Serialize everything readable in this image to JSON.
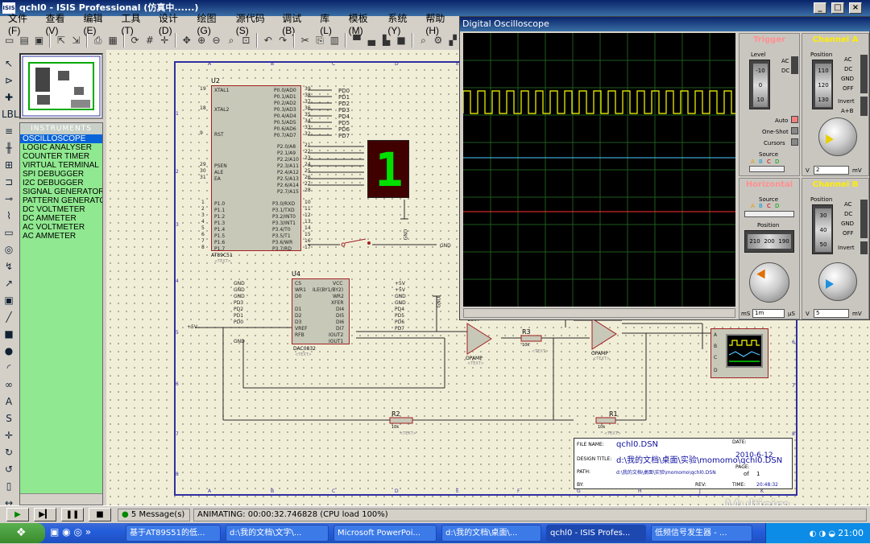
{
  "window": {
    "title": "qchl0 - ISIS Professional (仿真中......)",
    "icon_text": "ISIS"
  },
  "menu": [
    "文件(F)",
    "查看(V)",
    "编辑(E)",
    "工具(T)",
    "设计(D)",
    "绘图(G)",
    "源代码(S)",
    "调试(B)",
    "库(L)",
    "模板(M)",
    "系统(Y)",
    "帮助(H)"
  ],
  "instruments": {
    "header": "INSTRUMENTS",
    "items": [
      "OSCILLOSCOPE",
      "LOGIC ANALYSER",
      "COUNTER TIMER",
      "VIRTUAL TERMINAL",
      "SPI DEBUGGER",
      "I2C DEBUGGER",
      "SIGNAL GENERATOR",
      "PATTERN GENERATOR",
      "DC VOLTMETER",
      "DC AMMETER",
      "AC VOLTMETER",
      "AC AMMETER"
    ],
    "selected": "OSCILLOSCOPE"
  },
  "schematic": {
    "u2": {
      "ref": "U2",
      "part": "AT89C51",
      "text": "<TEXT>",
      "left_pins": [
        "XTAL1",
        "XTAL2",
        "RST",
        "PSEN",
        "ALE",
        "EA",
        "P1.0",
        "P1.1",
        "P1.2",
        "P1.3",
        "P1.4",
        "P1.5",
        "P1.6",
        "P1.7"
      ],
      "left_nums": [
        "19",
        "18",
        "9",
        "29",
        "30",
        "31",
        "1",
        "2",
        "3",
        "4",
        "5",
        "6",
        "7",
        "8"
      ],
      "right_pins": [
        "P0.0/AD0",
        "P0.1/AD1",
        "P0.2/AD2",
        "P0.3/AD3",
        "P0.4/AD4",
        "P0.5/AD5",
        "P0.6/AD6",
        "P0.7/AD7",
        "P2.0/A8",
        "P2.1/A9",
        "P2.2/A10",
        "P2.3/A11",
        "P2.4/A12",
        "P2.5/A13",
        "P2.6/A14",
        "P2.7/A15",
        "P3.0/RXD",
        "P3.1/TXD",
        "P3.2/INT0",
        "P3.3/INT1",
        "P3.4/T0",
        "P3.5/T1",
        "P3.6/WR",
        "P3.7/RD"
      ],
      "right_nums": [
        "39",
        "38",
        "37",
        "36",
        "35",
        "34",
        "33",
        "32",
        "21",
        "22",
        "23",
        "24",
        "25",
        "26",
        "27",
        "28",
        "10",
        "11",
        "12",
        "13",
        "14",
        "15",
        "16",
        "17"
      ]
    },
    "p0_labels": [
      "PD0",
      "PD1",
      "PD2",
      "PD3",
      "PD4",
      "PD5",
      "PD6",
      "PD7"
    ],
    "gnd": "GND",
    "display_digit": "1",
    "u4": {
      "ref": "U4",
      "part": "DAC0832",
      "text": "<TEXT>",
      "left_pins": [
        "CS",
        "WR1",
        "D0",
        "D1",
        "D2",
        "D3",
        "VREF",
        "RFB"
      ],
      "right_pins": [
        "VCC",
        "ILE(BY1/BY2)",
        "WR2",
        "XFER",
        "DI4",
        "DI5",
        "DI6",
        "DI7",
        "IOUT2",
        "IOUT1"
      ],
      "left_nets": [
        "GND",
        "GND",
        "GND",
        "PD3",
        "PD2",
        "PD1",
        "PD0",
        "GND"
      ],
      "right_nets": [
        "+5V",
        "+5V",
        "GND",
        "GND",
        "PD4",
        "PD5",
        "PD6",
        "PD7"
      ],
      "vref_net": "+5V"
    },
    "u3": {
      "ref": "U3:A",
      "part": "OPAMP",
      "text": "<TEXT>"
    },
    "opamp2": {
      "part": "OPAMP",
      "text": "<TEXT>"
    },
    "r3": {
      "ref": "R3",
      "value": "10k",
      "text": "<TEXT>"
    },
    "r2": {
      "ref": "R2",
      "value": "10k",
      "text": "<TEXT>"
    },
    "r1": {
      "ref": "R1",
      "value": "10k",
      "text": "<TEXT>"
    },
    "scope_channels": [
      "A",
      "B",
      "C",
      "D"
    ],
    "col_labels": [
      "A",
      "B",
      "C",
      "D",
      "E",
      "F",
      "G",
      "H",
      "J",
      "K"
    ],
    "row_labels": [
      "1",
      "2",
      "3",
      "4",
      "5",
      "6",
      "7",
      "8"
    ],
    "title_block": {
      "file_name_label": "FILE NAME:",
      "file_name": "qchl0.DSN",
      "design_title_label": "DESIGN TITLE:",
      "design_title": "d:\\我的文档\\桌面\\实验\\momomo\\qchl0.DSN",
      "path_label": "PATH:",
      "path": "d:\\我的文档\\桌面\\实验\\momomo\\qchl0.DSN",
      "by_label": "BY:",
      "rev_label": "REV:",
      "time_label": "TIME:",
      "time": "20:48:32",
      "date_label": "DATE:",
      "date": "2010-6-12",
      "page_label": "PAGE:",
      "page": "1",
      "of": "of",
      "pages": "1"
    }
  },
  "oscilloscope": {
    "title": "Digital Oscilloscope",
    "trigger": {
      "label": "Trigger",
      "level": "Level",
      "ac": "AC",
      "dc": "DC",
      "auto": "Auto",
      "one_shot": "One-Shot",
      "cursors": "Cursors",
      "source": "Source",
      "source_letters": [
        "A",
        "B",
        "C",
        "D"
      ],
      "scale": [
        "-10",
        "0",
        "10"
      ]
    },
    "channel_a": {
      "label": "Channel A",
      "position": "Position",
      "modes": [
        "AC",
        "DC",
        "GND",
        "OFF"
      ],
      "invert": "Invert",
      "a_plus_b": "A+B",
      "scale": [
        "110",
        "120",
        "130"
      ],
      "volts": "2",
      "unit_v": "V",
      "unit_mv": "mV"
    },
    "horizontal": {
      "label": "Horizontal",
      "source": "Source",
      "source_letters": [
        "A",
        "B",
        "C",
        "D"
      ],
      "position": "Position",
      "pos_scale": [
        "210",
        "200",
        "190"
      ],
      "time": "1m",
      "unit_ms": "mS",
      "unit_us": "µS"
    },
    "channel_b": {
      "label": "Channel B",
      "position": "Position",
      "modes": [
        "AC",
        "DC",
        "GND",
        "OFF"
      ],
      "invert": "Invert",
      "scale": [
        "30",
        "40",
        "50"
      ],
      "volts": "5",
      "unit_v": "V",
      "unit_mv": "mV"
    },
    "colors": {
      "grid": "#1e5a1e",
      "channel_a": "#ffff00",
      "channel_b": "#4fc8ff",
      "channel_c": "#ff3030",
      "trigger_label": "#ff9090",
      "channel_label": "#ffee00",
      "horizontal_label": "#ff9090"
    }
  },
  "sim": {
    "messages": "5 Message(s)",
    "status": "ANIMATING: 00:00:32.746828 (CPU load 100%)"
  },
  "watermark": "Multisim",
  "taskbar": {
    "tasks": [
      "基于AT89S51的低...",
      "d:\\我的文档\\文字\\...",
      "Microsoft PowerPoi...",
      "d:\\我的文档\\桌面\\...",
      "qchl0 - ISIS Profes...",
      "低频信号发生器 - ..."
    ],
    "active": 4,
    "clock": "21:00"
  }
}
